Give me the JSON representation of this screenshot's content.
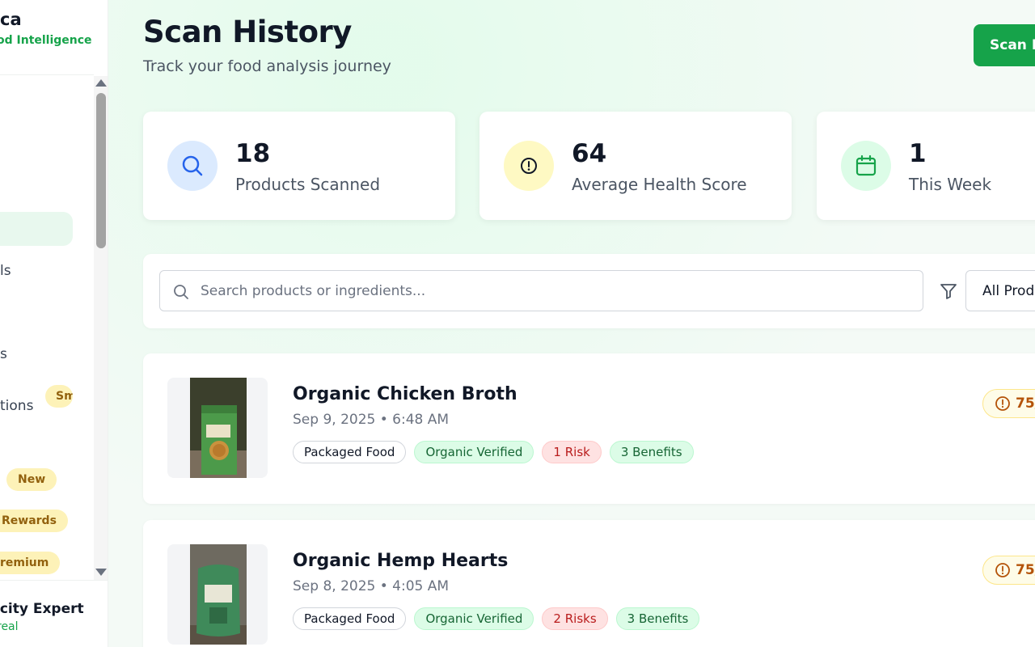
{
  "sidebar": {
    "brand_title": "ca",
    "brand_subtitle": "od Intelligence",
    "nav_items": [
      {
        "label": "ls"
      },
      {
        "label": "s"
      },
      {
        "label": "tions"
      }
    ],
    "badges": {
      "smart": "Sm",
      "new": "New",
      "rewards": "Rewards",
      "premium": "remium"
    },
    "footer_name": "icity Expert",
    "footer_sub": "real"
  },
  "header": {
    "title": "Scan History",
    "subtitle": "Track your food analysis journey",
    "scan_button": "Scan N"
  },
  "stats": [
    {
      "value": "18",
      "label": "Products Scanned",
      "icon": "search-icon",
      "color": "#dbeafe"
    },
    {
      "value": "64",
      "label": "Average Health Score",
      "icon": "alert-circle-icon",
      "color": "#fef9c3"
    },
    {
      "value": "1",
      "label": "This Week",
      "icon": "calendar-icon",
      "color": "#dcfce7"
    }
  ],
  "search": {
    "placeholder": "Search products or ingredients...",
    "filter_value": "All Produ"
  },
  "products": [
    {
      "name": "Organic Chicken Broth",
      "date": "Sep 9, 2025 • 6:48 AM",
      "tags": [
        "Packaged Food",
        "Organic Verified",
        "1 Risk",
        "3 Benefits"
      ],
      "score": "75/"
    },
    {
      "name": "Organic Hemp Hearts",
      "date": "Sep 8, 2025 • 4:05 AM",
      "tags": [
        "Packaged Food",
        "Organic Verified",
        "2 Risks",
        "3 Benefits"
      ],
      "score": "75/"
    }
  ],
  "colors": {
    "accent": "#16a34a",
    "score": "#b45309"
  }
}
